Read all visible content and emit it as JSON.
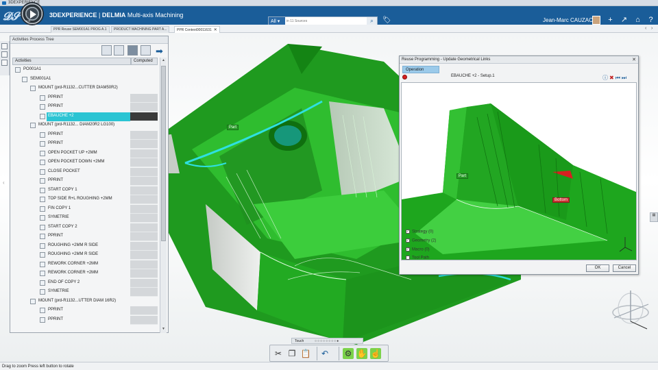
{
  "window_title": "3DEXPERIENCE",
  "app": {
    "brand": "3DEXPERIENCE",
    "separator": " | ",
    "product": "DELMIA",
    "title_rest": " Multi-axis Machining",
    "compass_version": "V.R"
  },
  "search": {
    "scope": "All",
    "placeholder": "in 11 Sources"
  },
  "user": {
    "name": "Jean-Marc CAUZAC"
  },
  "tabs": [
    {
      "label": "PPR Reuse SEM001A1 PROG A.1"
    },
    {
      "label": "PRODUCT MACHINING PART A..."
    },
    {
      "label": "PPR Context00011631",
      "close": "✕"
    }
  ],
  "panel": {
    "title": "Activities Process Tree",
    "col_activities": "Activities",
    "col_computed": "Computed"
  },
  "tree": [
    {
      "label": "PO001A1",
      "level": 0,
      "icon": "po-icon"
    },
    {
      "label": "SEM001A1",
      "level": 1,
      "icon": "setup-icon"
    },
    {
      "label": "MOUNT (prd-R1132...CUTTER DIAM50R2)",
      "level": 2,
      "icon": "tool-mount-icon"
    },
    {
      "label": "PPRINT",
      "level": 3,
      "icon": "pprint-icon"
    },
    {
      "label": "PPRINT",
      "level": 3,
      "icon": "pprint-icon"
    },
    {
      "label": "EBAUCHE +2",
      "level": 3,
      "icon": "operation-icon",
      "selected": true
    },
    {
      "label": "MOUNT (prd-R1132... DIAM20R2 LG100)",
      "level": 2,
      "icon": "tool-mount-icon"
    },
    {
      "label": "PPRINT",
      "level": 3,
      "icon": "pprint-icon"
    },
    {
      "label": "PPRINT",
      "level": 3,
      "icon": "pprint-icon"
    },
    {
      "label": "OPEN POCKET UP +2MM",
      "level": 3,
      "icon": "operation-icon"
    },
    {
      "label": "OPEN POCKET DOWN +2MM",
      "level": 3,
      "icon": "operation-icon"
    },
    {
      "label": "CLOSE POCKET",
      "level": 3,
      "icon": "operation-icon"
    },
    {
      "label": "PPRINT",
      "level": 3,
      "icon": "pprint-icon"
    },
    {
      "label": "START COPY 1",
      "level": 3,
      "icon": "copy-icon"
    },
    {
      "label": "TOP SIDE R+L ROUGHING +2MM",
      "level": 3,
      "icon": "operation-icon"
    },
    {
      "label": "FIN COPY 1",
      "level": 3,
      "icon": "copy-icon"
    },
    {
      "label": "SYMETRIE",
      "level": 3,
      "icon": "symmetry-icon"
    },
    {
      "label": "START COPY 2",
      "level": 3,
      "icon": "copy-icon"
    },
    {
      "label": "PPRINT",
      "level": 3,
      "icon": "pprint-icon"
    },
    {
      "label": "ROUGHING +2MM R SIDE",
      "level": 3,
      "icon": "operation-icon"
    },
    {
      "label": "ROUGHING +2MM R SIDE",
      "level": 3,
      "icon": "operation-icon"
    },
    {
      "label": "REWORK CORNER +2MM",
      "level": 3,
      "icon": "operation-icon"
    },
    {
      "label": "REWORK CORNER +2MM",
      "level": 3,
      "icon": "operation-icon"
    },
    {
      "label": "END OF COPY 2",
      "level": 3,
      "icon": "copy-icon"
    },
    {
      "label": "SYMETRIE",
      "level": 3,
      "icon": "symmetry-icon"
    },
    {
      "label": "MOUNT (prd-R1132...UTTER DIAM 16R2)",
      "level": 2,
      "icon": "tool-mount-icon"
    },
    {
      "label": "PPRINT",
      "level": 3,
      "icon": "pprint-icon"
    },
    {
      "label": "PPRINT",
      "level": 3,
      "icon": "pprint-icon"
    }
  ],
  "viewport_labels": {
    "part_main": "Part",
    "part_dialog": "Part",
    "bottom_dialog": "Bottom"
  },
  "dialog": {
    "title": "Reuse Programming - Update Geometrical Links",
    "close": "✕",
    "tab_operation": "Operation",
    "subtitle": "EBAUCHE +2 - Setup.1",
    "checks": [
      {
        "label": "Strategy (0)",
        "checked": true
      },
      {
        "label": "Geometry (2)",
        "checked": true
      },
      {
        "label": "Macro (0)",
        "checked": true
      },
      {
        "label": "Tool Path",
        "checked": false
      }
    ],
    "ok": "OK",
    "cancel": "Cancel"
  },
  "touch": {
    "label": "Touch",
    "dots": "○○○○○○○○●"
  },
  "status": {
    "text": "Drag to zoom   Press left button to rotate"
  },
  "colors": {
    "appbar": "#1a5d99",
    "part_green": "#22b422",
    "selection": "#2bc4d3",
    "highlight_cyan": "#2ee0e0"
  }
}
